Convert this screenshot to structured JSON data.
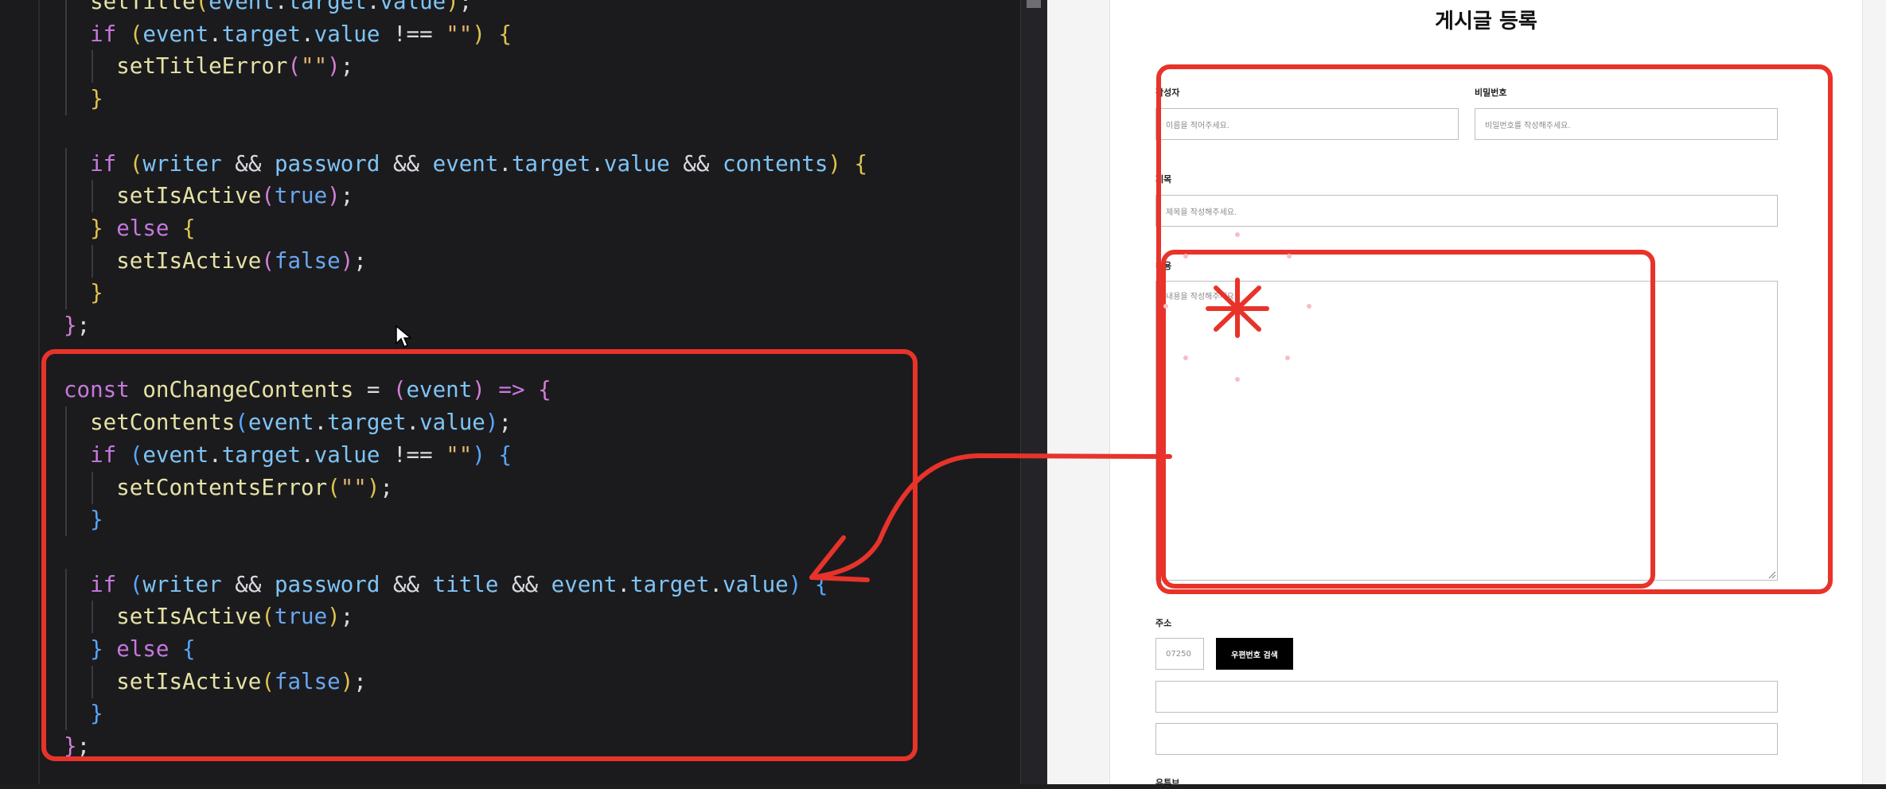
{
  "editor": {
    "lines": [
      [
        "  ",
        [
          "fn",
          "setTitle"
        ],
        [
          "br",
          "("
        ],
        [
          "var",
          "event"
        ],
        ".",
        [
          "var",
          "target"
        ],
        ".",
        [
          "var",
          "value"
        ],
        [
          "br",
          ")"
        ],
        ";"
      ],
      [
        "  ",
        [
          "kw",
          "if"
        ],
        " ",
        [
          "br",
          "("
        ],
        [
          "var",
          "event"
        ],
        ".",
        [
          "var",
          "target"
        ],
        ".",
        [
          "var",
          "value"
        ],
        " !== ",
        [
          "str",
          "\"\""
        ],
        [
          "br",
          ")"
        ],
        " ",
        [
          "br",
          "{"
        ]
      ],
      [
        "    ",
        [
          "fn",
          "setTitleError"
        ],
        [
          "br2",
          "("
        ],
        [
          "str",
          "\"\""
        ],
        [
          "br2",
          ")"
        ],
        ";"
      ],
      [
        "  ",
        [
          "br",
          "}"
        ]
      ],
      [
        ""
      ],
      [
        "  ",
        [
          "kw",
          "if"
        ],
        " ",
        [
          "br",
          "("
        ],
        [
          "var",
          "writer"
        ],
        " && ",
        [
          "var",
          "password"
        ],
        " && ",
        [
          "var",
          "event"
        ],
        ".",
        [
          "var",
          "target"
        ],
        ".",
        [
          "var",
          "value"
        ],
        " && ",
        [
          "var",
          "contents"
        ],
        [
          "br",
          ")"
        ],
        " ",
        [
          "br",
          "{"
        ]
      ],
      [
        "    ",
        [
          "fn",
          "setIsActive"
        ],
        [
          "br2",
          "("
        ],
        [
          "bool",
          "true"
        ],
        [
          "br2",
          ")"
        ],
        ";"
      ],
      [
        "  ",
        [
          "br",
          "}"
        ],
        " ",
        [
          "kw",
          "else"
        ],
        " ",
        [
          "br",
          "{"
        ]
      ],
      [
        "    ",
        [
          "fn",
          "setIsActive"
        ],
        [
          "br2",
          "("
        ],
        [
          "bool",
          "false"
        ],
        [
          "br2",
          ")"
        ],
        ";"
      ],
      [
        "  ",
        [
          "br",
          "}"
        ]
      ],
      [
        [
          "br2",
          "}"
        ],
        ";"
      ],
      [
        ""
      ],
      [
        [
          "kw",
          "const"
        ],
        " ",
        [
          "fn",
          "onChangeContents"
        ],
        " = ",
        [
          "br2",
          "("
        ],
        [
          "var",
          "event"
        ],
        [
          "br2",
          ")"
        ],
        " ",
        [
          "kw",
          "=>"
        ],
        " ",
        [
          "br2",
          "{"
        ]
      ],
      [
        "  ",
        [
          "fn",
          "setContents"
        ],
        [
          "br3",
          "("
        ],
        [
          "var",
          "event"
        ],
        ".",
        [
          "var",
          "target"
        ],
        ".",
        [
          "var",
          "value"
        ],
        [
          "br3",
          ")"
        ],
        ";"
      ],
      [
        "  ",
        [
          "kw",
          "if"
        ],
        " ",
        [
          "br3",
          "("
        ],
        [
          "var",
          "event"
        ],
        ".",
        [
          "var",
          "target"
        ],
        ".",
        [
          "var",
          "value"
        ],
        " !== ",
        [
          "str",
          "\"\""
        ],
        [
          "br3",
          ")"
        ],
        " ",
        [
          "br3",
          "{"
        ]
      ],
      [
        "    ",
        [
          "fn",
          "setContentsError"
        ],
        [
          "br",
          "("
        ],
        [
          "str",
          "\"\""
        ],
        [
          "br",
          ")"
        ],
        ";"
      ],
      [
        "  ",
        [
          "br3",
          "}"
        ]
      ],
      [
        ""
      ],
      [
        "  ",
        [
          "kw",
          "if"
        ],
        " ",
        [
          "br3",
          "("
        ],
        [
          "var",
          "writer"
        ],
        " && ",
        [
          "var",
          "password"
        ],
        " && ",
        [
          "var",
          "title"
        ],
        " && ",
        [
          "var",
          "event"
        ],
        ".",
        [
          "var",
          "target"
        ],
        ".",
        [
          "var",
          "value"
        ],
        [
          "br3",
          ")"
        ],
        " ",
        [
          "br3",
          "{"
        ]
      ],
      [
        "    ",
        [
          "fn",
          "setIsActive"
        ],
        [
          "br",
          "("
        ],
        [
          "bool",
          "true"
        ],
        [
          "br",
          ")"
        ],
        ";"
      ],
      [
        "  ",
        [
          "br3",
          "}"
        ],
        " ",
        [
          "kw",
          "else"
        ],
        " ",
        [
          "br3",
          "{"
        ]
      ],
      [
        "    ",
        [
          "fn",
          "setIsActive"
        ],
        [
          "br",
          "("
        ],
        [
          "bool",
          "false"
        ],
        [
          "br",
          ")"
        ],
        ";"
      ],
      [
        "  ",
        [
          "br3",
          "}"
        ]
      ],
      [
        [
          "br2",
          "}"
        ],
        ";"
      ]
    ]
  },
  "form": {
    "title": "게시글 등록",
    "writer_label": "작성자",
    "writer_placeholder": "이름을 적어주세요.",
    "password_label": "비밀번호",
    "password_placeholder": "비밀번호를 작성해주세요.",
    "subject_label": "제목",
    "subject_placeholder": "제목을 작성해주세요.",
    "contents_label": "내용",
    "contents_placeholder": "내용을 작성해주세요.",
    "address_label": "주소",
    "zipcode_value": "07250",
    "zipcode_button": "우편번호 검색",
    "address1_value": "",
    "address2_value": "",
    "next_label": "유튜브"
  },
  "colors": {
    "annotation_red": "#e8332a",
    "editor_bg": "#1b1b1e",
    "preview_bg": "#ffffff"
  }
}
